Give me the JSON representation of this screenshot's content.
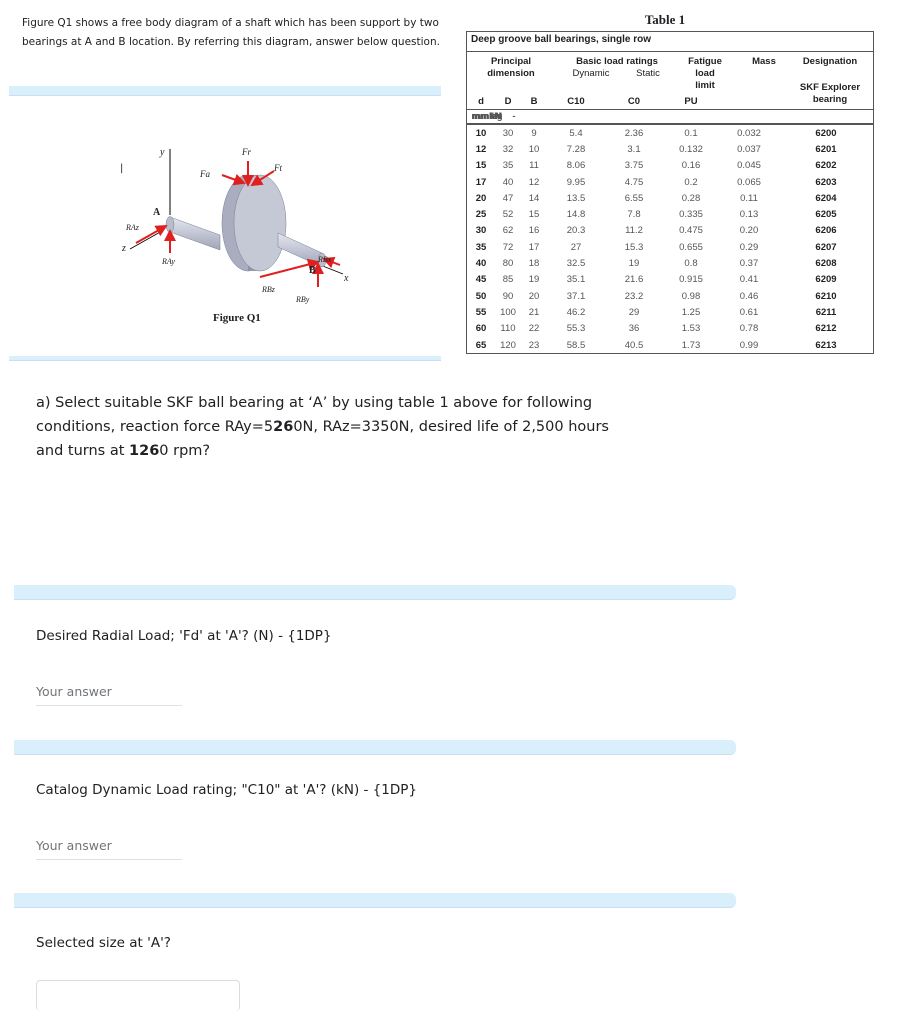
{
  "intro": {
    "text": "Figure Q1 shows a free body diagram of a shaft which has been support by two bearings at A and B location. By referring this diagram, answer below question."
  },
  "figure": {
    "caption": "Figure Q1",
    "labels": {
      "y_axis": "y",
      "z_axis": "z",
      "x_axis": "x",
      "point_a": "A",
      "point_b": "B",
      "fr": "Fr",
      "ft": "Ft",
      "fa": "Fa",
      "rax": "RAz",
      "ray": "RAy",
      "rbx": "RBx",
      "rbz": "RBz",
      "rby": "RBy",
      "stray_mark": "|"
    },
    "colors": {
      "arrow": "#e02020",
      "shaft": "#c8ccd8"
    }
  },
  "table": {
    "title": "Table 1",
    "subtitle": "Deep groove ball bearings, single row",
    "headers": {
      "principal": "Principal",
      "dimension": "dimension",
      "basic_load": "Basic load ratings",
      "dynamic": "Dynamic",
      "static": "Static",
      "fatigue": "Fatigue",
      "load": "load",
      "limit": "limit",
      "mass": "Mass",
      "designation": "Designation",
      "skf_explorer": "SKF Explorer",
      "bearing": "bearing",
      "d": "d",
      "D": "D",
      "B": "B",
      "c10": "C10",
      "c0": "C0",
      "pu": "PU"
    },
    "units": [
      "mm",
      "mm",
      "mm",
      "kN",
      "kN",
      "kN",
      "kg",
      "-"
    ],
    "rows": [
      [
        "10",
        "30",
        "9",
        "5.4",
        "2.36",
        "0.1",
        "0.032",
        "6200"
      ],
      [
        "12",
        "32",
        "10",
        "7.28",
        "3.1",
        "0.132",
        "0.037",
        "6201"
      ],
      [
        "15",
        "35",
        "11",
        "8.06",
        "3.75",
        "0.16",
        "0.045",
        "6202"
      ],
      [
        "17",
        "40",
        "12",
        "9.95",
        "4.75",
        "0.2",
        "0.065",
        "6203"
      ],
      [
        "20",
        "47",
        "14",
        "13.5",
        "6.55",
        "0.28",
        "0.11",
        "6204"
      ],
      [
        "25",
        "52",
        "15",
        "14.8",
        "7.8",
        "0.335",
        "0.13",
        "6205"
      ],
      [
        "30",
        "62",
        "16",
        "20.3",
        "11.2",
        "0.475",
        "0.20",
        "6206"
      ],
      [
        "35",
        "72",
        "17",
        "27",
        "15.3",
        "0.655",
        "0.29",
        "6207"
      ],
      [
        "40",
        "80",
        "18",
        "32.5",
        "19",
        "0.8",
        "0.37",
        "6208"
      ],
      [
        "45",
        "85",
        "19",
        "35.1",
        "21.6",
        "0.915",
        "0.41",
        "6209"
      ],
      [
        "50",
        "90",
        "20",
        "37.1",
        "23.2",
        "0.98",
        "0.46",
        "6210"
      ],
      [
        "55",
        "100",
        "21",
        "46.2",
        "29",
        "1.25",
        "0.61",
        "6211"
      ],
      [
        "60",
        "110",
        "22",
        "55.3",
        "36",
        "1.53",
        "0.78",
        "6212"
      ],
      [
        "65",
        "120",
        "23",
        "58.5",
        "40.5",
        "1.73",
        "0.99",
        "6213"
      ]
    ]
  },
  "question": {
    "line1": "a) Select suitable SKF ball bearing at ‘A’ by using table 1 above for following",
    "line2_a": "conditions, reaction force RAy=5",
    "line2_bold": "26",
    "line2_b": "0N, RAz=3350N, desired life of 2,500 hours",
    "line3_a": "and turns at ",
    "line3_bold": "126",
    "line3_b": "0 rpm?"
  },
  "fields": [
    {
      "label": "Desired Radial Load; 'Fd' at 'A'? (N) - {1DP}",
      "placeholder": "Your answer",
      "value": ""
    },
    {
      "label": "Catalog Dynamic Load rating; \"C10\" at 'A'? (kN) - {1DP}",
      "placeholder": "Your answer",
      "value": ""
    },
    {
      "label": "Selected size at 'A'?",
      "value": ""
    }
  ],
  "colors": {
    "band": "#d9effc",
    "text": "#202124",
    "placeholder": "#70757a"
  }
}
